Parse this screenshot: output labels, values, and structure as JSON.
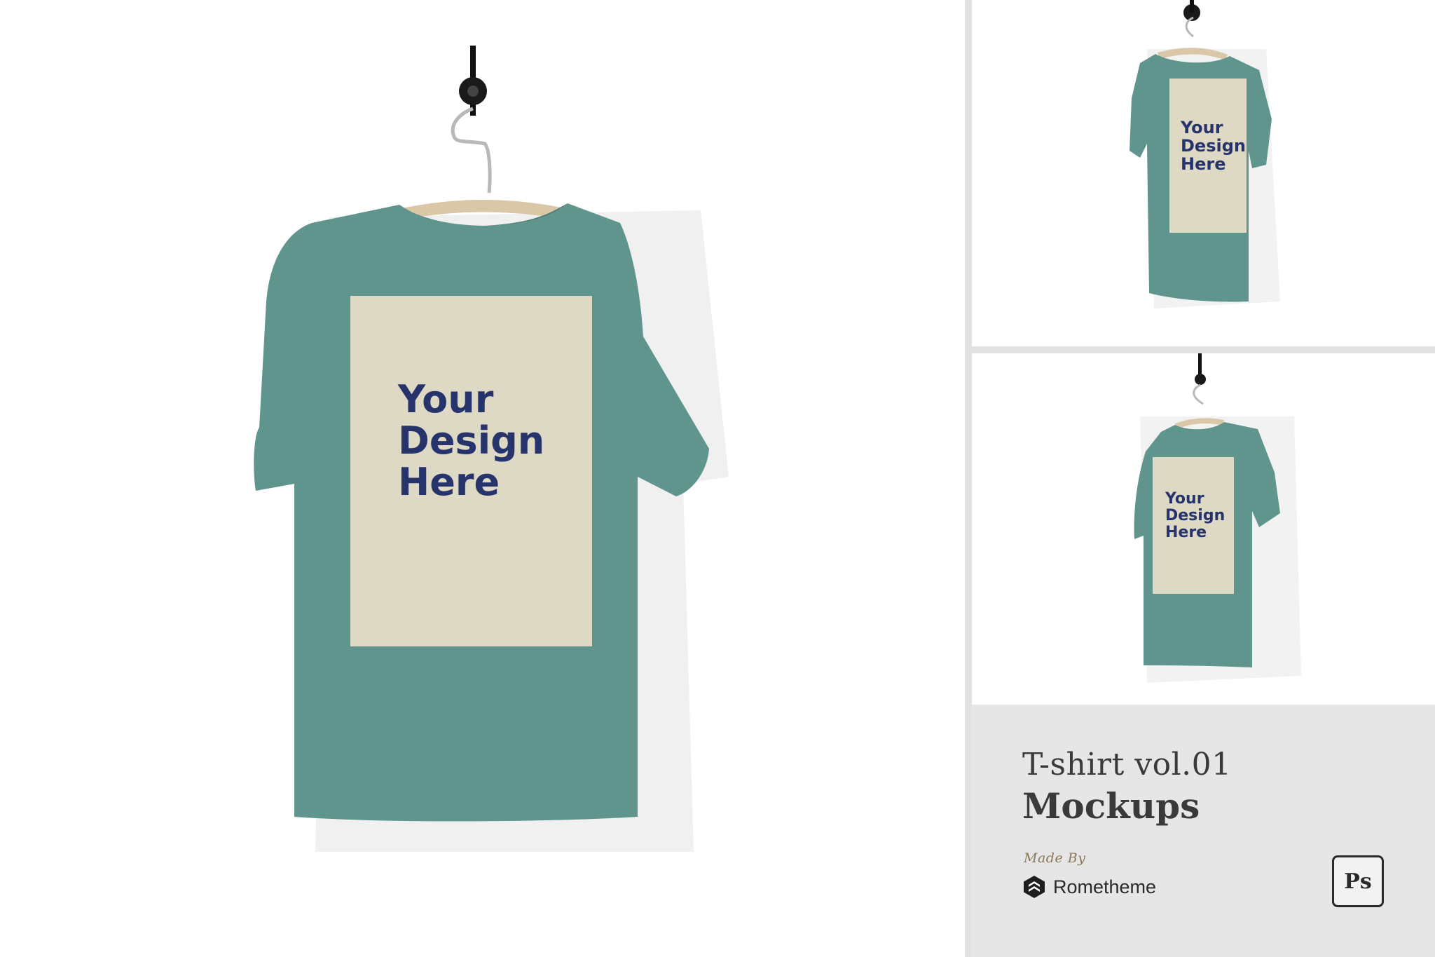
{
  "colors": {
    "shirt": "#5f958d",
    "shirt_dark": "#4d7f78",
    "print_area": "#ddd9c5",
    "print_text": "#27346b",
    "hanger": "#d9c7a8",
    "background": "#ffffff",
    "info_panel": "#e6e6e6"
  },
  "mockups": {
    "main": {
      "design_line1": "Your",
      "design_line2": "Design",
      "design_line3": "Here"
    },
    "top": {
      "design_line1": "Your",
      "design_line2": "Design",
      "design_line3": "Here"
    },
    "middle": {
      "design_line1": "Your",
      "design_line2": "Design",
      "design_line3": "Here"
    }
  },
  "info": {
    "title_line1": "T-shirt vol.01",
    "title_line2": "Mockups",
    "made_by": "Made By",
    "brand": "Rometheme",
    "software_badge": "Ps"
  },
  "icons": [
    "wall-hook-icon",
    "hanger-icon",
    "rometheme-logo-icon",
    "photoshop-icon"
  ]
}
